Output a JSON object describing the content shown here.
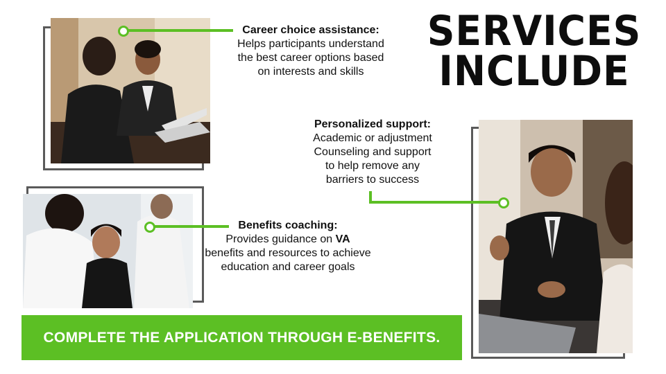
{
  "slide": {
    "title_line1": "SERVICES",
    "title_line2": "INCLUDE"
  },
  "services": [
    {
      "heading": "Career choice assistance:",
      "body": "Helps participants understand\nthe best career options based\non interests and skills"
    },
    {
      "heading": "Personalized support:",
      "body": "Academic or adjustment\nCounseling and support\nto help remove any\nbarriers to success"
    },
    {
      "heading": "Benefits coaching:",
      "body_prefix": "Provides guidance on ",
      "body_bold": "VA",
      "body_rest": "benefits and resources to achieve\neducation and career goals"
    }
  ],
  "cta": {
    "label": "COMPLETE THE APPLICATION THROUGH E-BENEFITS."
  },
  "colors": {
    "accent": "#5cbf24",
    "frame": "#5a5a5a",
    "title": "#0d0d0d"
  },
  "images": {
    "photo1": "business meeting with laptop",
    "photo2": "coaching consultation",
    "photo3": "smiling advisor in meeting"
  }
}
